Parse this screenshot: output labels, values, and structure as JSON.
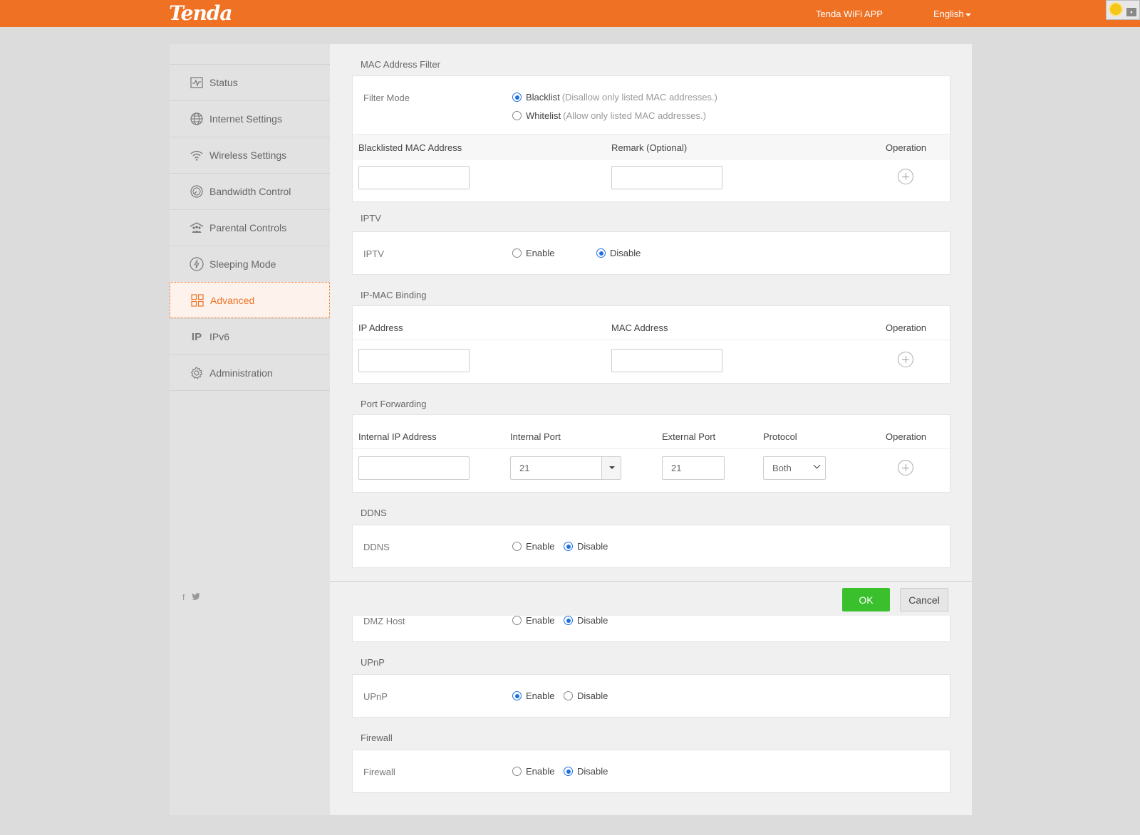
{
  "header": {
    "logo": "Tenda",
    "app_link": "Tenda WiFi APP",
    "language": "English"
  },
  "sidebar": {
    "items": [
      {
        "label": "Status",
        "icon": "status-chart-icon"
      },
      {
        "label": "Internet Settings",
        "icon": "globe-icon"
      },
      {
        "label": "Wireless Settings",
        "icon": "wifi-icon"
      },
      {
        "label": "Bandwidth Control",
        "icon": "gauge-icon"
      },
      {
        "label": "Parental Controls",
        "icon": "family-icon"
      },
      {
        "label": "Sleeping Mode",
        "icon": "sleep-icon"
      },
      {
        "label": "Advanced",
        "icon": "grid-icon",
        "active": true
      },
      {
        "label": "IPv6",
        "icon": "ipv6-icon"
      },
      {
        "label": "Administration",
        "icon": "gear-icon"
      }
    ],
    "social": {
      "facebook": "f"
    }
  },
  "mac_filter": {
    "title": "MAC Address Filter",
    "filter_mode_label": "Filter Mode",
    "blacklist": "Blacklist",
    "blacklist_hint": "(Disallow only listed MAC addresses.)",
    "whitelist": "Whitelist",
    "whitelist_hint": "(Allow only listed MAC addresses.)",
    "selected": "Blacklist",
    "col_mac": "Blacklisted MAC Address",
    "col_remark": "Remark (Optional)",
    "col_op": "Operation"
  },
  "iptv": {
    "title": "IPTV",
    "label": "IPTV",
    "enable": "Enable",
    "disable": "Disable",
    "selected": "Disable"
  },
  "ipmac": {
    "title": "IP-MAC Binding",
    "col_ip": "IP Address",
    "col_mac": "MAC Address",
    "col_op": "Operation"
  },
  "port_forwarding": {
    "title": "Port Forwarding",
    "col_ip": "Internal IP Address",
    "col_internal_port": "Internal Port",
    "col_external_port": "External Port",
    "col_protocol": "Protocol",
    "col_op": "Operation",
    "internal_port_value": "21",
    "external_port_value": "21",
    "protocol_value": "Both"
  },
  "ddns": {
    "title": "DDNS",
    "label": "DDNS",
    "enable": "Enable",
    "disable": "Disable",
    "selected": "Disable"
  },
  "dmz": {
    "label": "DMZ Host",
    "enable": "Enable",
    "disable": "Disable",
    "selected": "Disable"
  },
  "upnp": {
    "title": "UPnP",
    "label": "UPnP",
    "enable": "Enable",
    "disable": "Disable",
    "selected": "Enable"
  },
  "firewall": {
    "title": "Firewall",
    "label": "Firewall",
    "enable": "Enable",
    "disable": "Disable",
    "selected": "Disable"
  },
  "actions": {
    "ok": "OK",
    "cancel": "Cancel"
  },
  "colors": {
    "brand": "#ee7124",
    "ok_green": "#3ac02d",
    "radio_blue": "#1e6fe0"
  }
}
